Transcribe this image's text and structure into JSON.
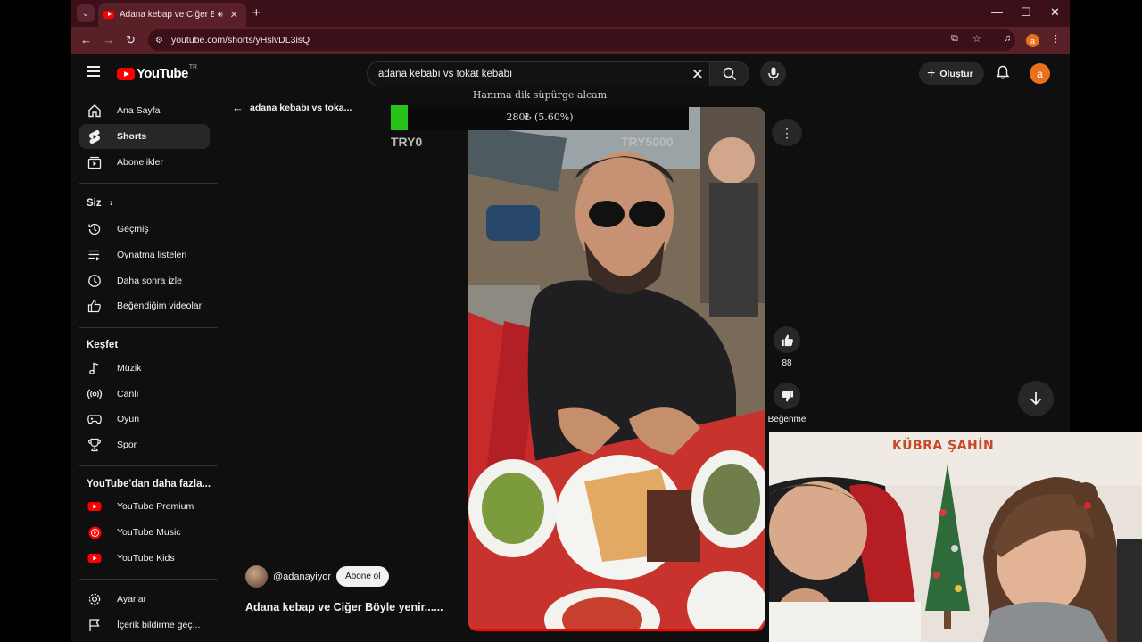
{
  "browser": {
    "tab_title": "Adana kebap ve Ciğer Böyle yenir",
    "url": "youtube.com/shorts/yHslvDL3isQ",
    "profile_initial": "a"
  },
  "youtube": {
    "logo_text": "YouTube",
    "logo_region": "TR",
    "search_value": "adana kebabı vs tokat kebabı",
    "create_label": "Oluştur",
    "avatar_initial": "a"
  },
  "sidebar": {
    "main": [
      {
        "label": "Ana Sayfa",
        "icon": "home-icon"
      },
      {
        "label": "Shorts",
        "icon": "shorts-icon",
        "active": true
      },
      {
        "label": "Abonelikler",
        "icon": "subscriptions-icon"
      }
    ],
    "you_heading": "Siz",
    "you": [
      {
        "label": "Geçmiş",
        "icon": "history-icon"
      },
      {
        "label": "Oynatma listeleri",
        "icon": "playlists-icon"
      },
      {
        "label": "Daha sonra izle",
        "icon": "watch-later-icon"
      },
      {
        "label": "Beğendiğim videolar",
        "icon": "liked-icon"
      }
    ],
    "explore_heading": "Keşfet",
    "explore": [
      {
        "label": "Müzik",
        "icon": "music-icon"
      },
      {
        "label": "Canlı",
        "icon": "live-icon"
      },
      {
        "label": "Oyun",
        "icon": "gaming-icon"
      },
      {
        "label": "Spor",
        "icon": "sports-icon"
      }
    ],
    "more_heading": "YouTube'dan daha fazla...",
    "more": [
      {
        "label": "YouTube Premium",
        "icon": "youtube-premium-icon"
      },
      {
        "label": "YouTube Music",
        "icon": "youtube-music-icon"
      },
      {
        "label": "YouTube Kids",
        "icon": "youtube-kids-icon"
      }
    ],
    "bottom": [
      {
        "label": "Ayarlar",
        "icon": "settings-icon"
      },
      {
        "label": "İçerik bildirme geç...",
        "icon": "report-flag-icon"
      }
    ]
  },
  "shorts": {
    "back_title": "adana kebabı vs toka...",
    "like_count": "88",
    "dislike_label": "Beğenme",
    "channel_handle": "@adanayiyor",
    "subscribe_label": "Abone ol",
    "video_title": "Adana kebap ve Ciğer Böyle yenir......"
  },
  "donation_goal": {
    "title": "Hanıma dik süpürge alcam",
    "progress_text": "280₺ (5.60%)",
    "progress_fraction": 0.056,
    "min_label": "TRY0",
    "max_label": "TRY5000",
    "fill_color": "#26c41a"
  },
  "webcam": {
    "streamer_name": "KÜBRA ŞAHİN"
  }
}
